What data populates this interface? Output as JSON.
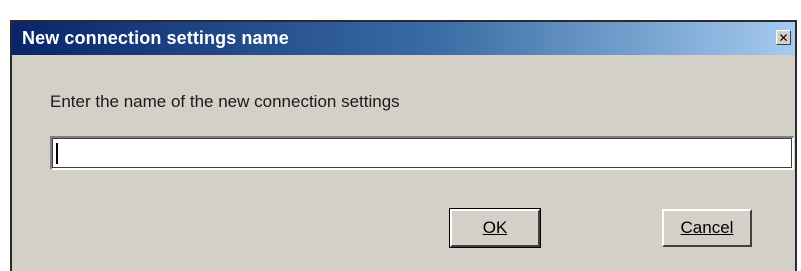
{
  "window": {
    "title": "New connection settings name",
    "close_glyph": "✕"
  },
  "dialog": {
    "prompt": "Enter the name of the new connection settings",
    "input_value": ""
  },
  "buttons": {
    "ok_label": "OK",
    "cancel_label": "Cancel"
  },
  "colors": {
    "title_gradient_start": "#0a246a",
    "title_gradient_end": "#a6caf0",
    "dialog_bg": "#d4d0c8"
  },
  "icons": {
    "close": "close-icon"
  }
}
